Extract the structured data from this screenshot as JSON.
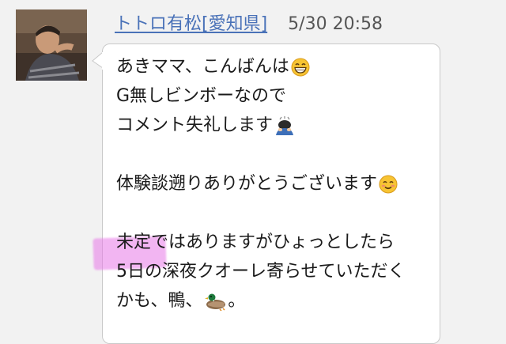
{
  "post": {
    "author": "トトロ有松[愛知県]",
    "timestamp": "5/30 20:58"
  },
  "message": {
    "line1": "あきママ、こんばんは",
    "line2": "G無しビンボーなので",
    "line3": "コメント失礼します",
    "line4": "体験談遡りありがとうございます",
    "line5": "未定ではありますがひょっとしたら",
    "line6": "5日の深夜クオーレ寄らせていただく",
    "line7": "かも、鴨、",
    "line7_end": "。"
  },
  "icons": {
    "line1_emoji": "grinning-face-icon",
    "line3_emoji": "bowing-person-icon",
    "line4_emoji": "smiling-face-icon",
    "line7_emoji": "duck-icon"
  },
  "colors": {
    "author_link": "#4a72b8",
    "highlight": "#e878e8",
    "background": "#f2f2f2",
    "bubble": "#ffffff"
  }
}
